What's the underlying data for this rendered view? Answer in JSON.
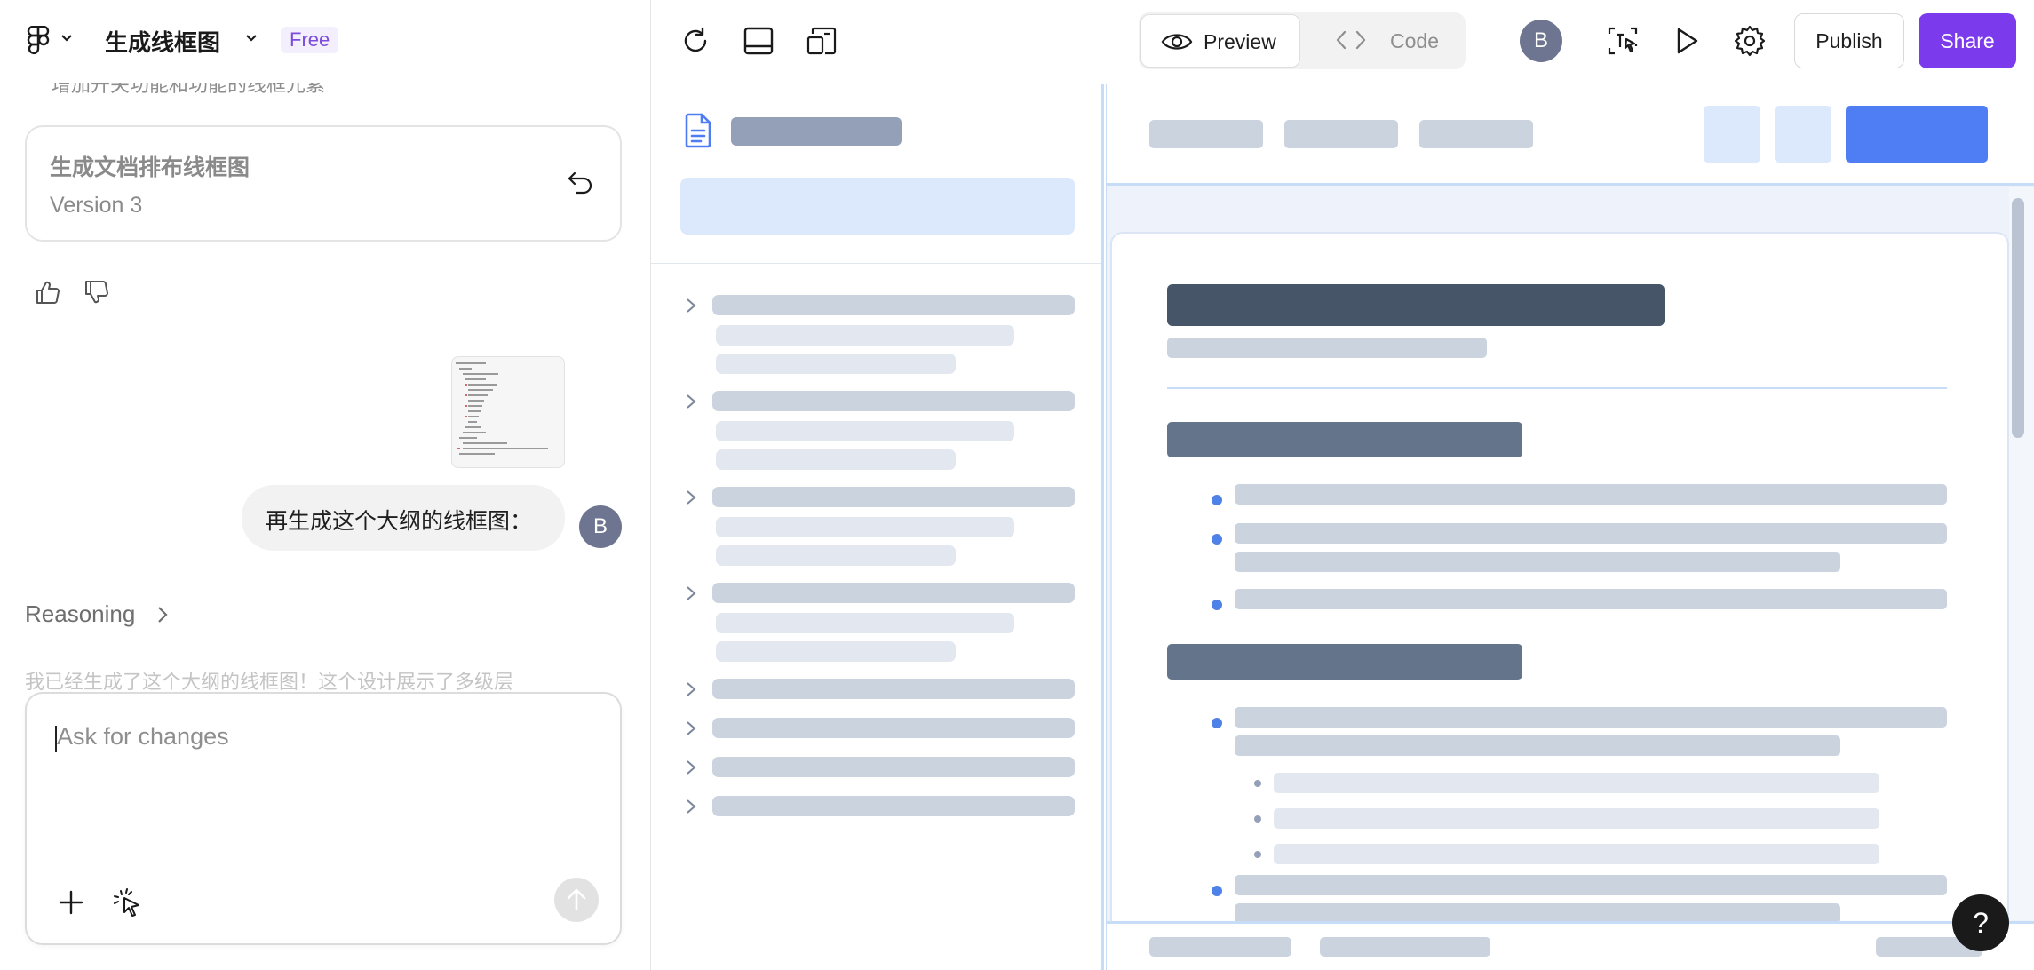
{
  "app": {
    "file_title": "生成线框图",
    "plan_badge": "Free"
  },
  "chat": {
    "clipped_line": "增加开关功能和功能的线框元素",
    "version_card": {
      "title": "生成文档排布线框图",
      "version": "Version 3"
    },
    "user_message": "再生成这个大纲的线框图：",
    "user_avatar_initial": "B",
    "reasoning_label": "Reasoning",
    "faded_response": "我已经生成了这个大纲的线框图！这个设计展示了多级层",
    "input_placeholder": "Ask for changes"
  },
  "toolbar": {
    "preview_label": "Preview",
    "code_label": "Code",
    "avatar_initial": "B",
    "publish_label": "Publish",
    "share_label": "Share",
    "active_view": "Preview"
  },
  "help": {
    "label": "?"
  },
  "colors": {
    "accent_purple": "#7c3aed",
    "skeleton_dark": "#475569",
    "skeleton_mid": "#64748b",
    "skeleton_light": "#cbd3df",
    "highlight_blue": "#dce8fb",
    "primary_blue": "#4f7df3"
  },
  "icons": {
    "toolbar": [
      "refresh-icon",
      "panel-bottom-icon",
      "responsive-icon",
      "dev-mode-icon",
      "play-icon",
      "settings-icon"
    ],
    "chat": [
      "undo-icon",
      "thumbs-up-icon",
      "thumbs-down-icon",
      "plus-icon",
      "select-element-icon",
      "send-icon"
    ]
  }
}
